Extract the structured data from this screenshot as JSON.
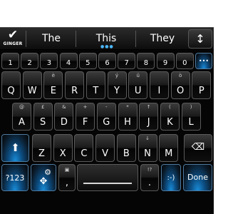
{
  "suggestion_bar": {
    "ginger_label": "GINGER",
    "suggestions": [
      "The",
      "This",
      "They"
    ]
  },
  "number_row": [
    "1",
    "2",
    "3",
    "4",
    "5",
    "6",
    "7",
    "8",
    "9",
    "0"
  ],
  "row1": [
    {
      "main": "Q",
      "alt": ""
    },
    {
      "main": "W",
      "alt": ""
    },
    {
      "main": "E",
      "alt": "è"
    },
    {
      "main": "R",
      "alt": ""
    },
    {
      "main": "T",
      "alt": ""
    },
    {
      "main": "Y",
      "alt": "ý"
    },
    {
      "main": "U",
      "alt": "ü"
    },
    {
      "main": "I",
      "alt": ""
    },
    {
      "main": "O",
      "alt": "ò"
    },
    {
      "main": "P",
      "alt": ""
    }
  ],
  "row2": [
    {
      "main": "A",
      "alt": "@"
    },
    {
      "main": "S",
      "alt": "£"
    },
    {
      "main": "D",
      "alt": "&"
    },
    {
      "main": "F",
      "alt": "+"
    },
    {
      "main": "G",
      "alt": "-"
    },
    {
      "main": "H",
      "alt": "*"
    },
    {
      "main": "J",
      "alt": "↑"
    },
    {
      "main": "K",
      "alt": "("
    },
    {
      "main": "L",
      "alt": ")"
    }
  ],
  "row3": [
    {
      "main": "Z",
      "alt": ""
    },
    {
      "main": "X",
      "alt": ""
    },
    {
      "main": "C",
      "alt": ""
    },
    {
      "main": "V",
      "alt": ""
    },
    {
      "main": "B",
      "alt": ""
    },
    {
      "main": "N",
      "alt": "↓"
    },
    {
      "main": "M",
      "alt": ""
    }
  ],
  "bottom_row": {
    "symbols_label": "?123",
    "comma_label": ",",
    "period_label": ".",
    "period_alt": "!?",
    "smiley_label": ":-)",
    "done_label": "Done"
  },
  "colors": {
    "accent_blue": "#1a8dd8",
    "key_background": "#1a1a1a"
  },
  "icons": [
    "checkmark-icon",
    "up-down-arrow-icon",
    "shift-arrow-icon",
    "backspace-icon",
    "settings-icon"
  ]
}
